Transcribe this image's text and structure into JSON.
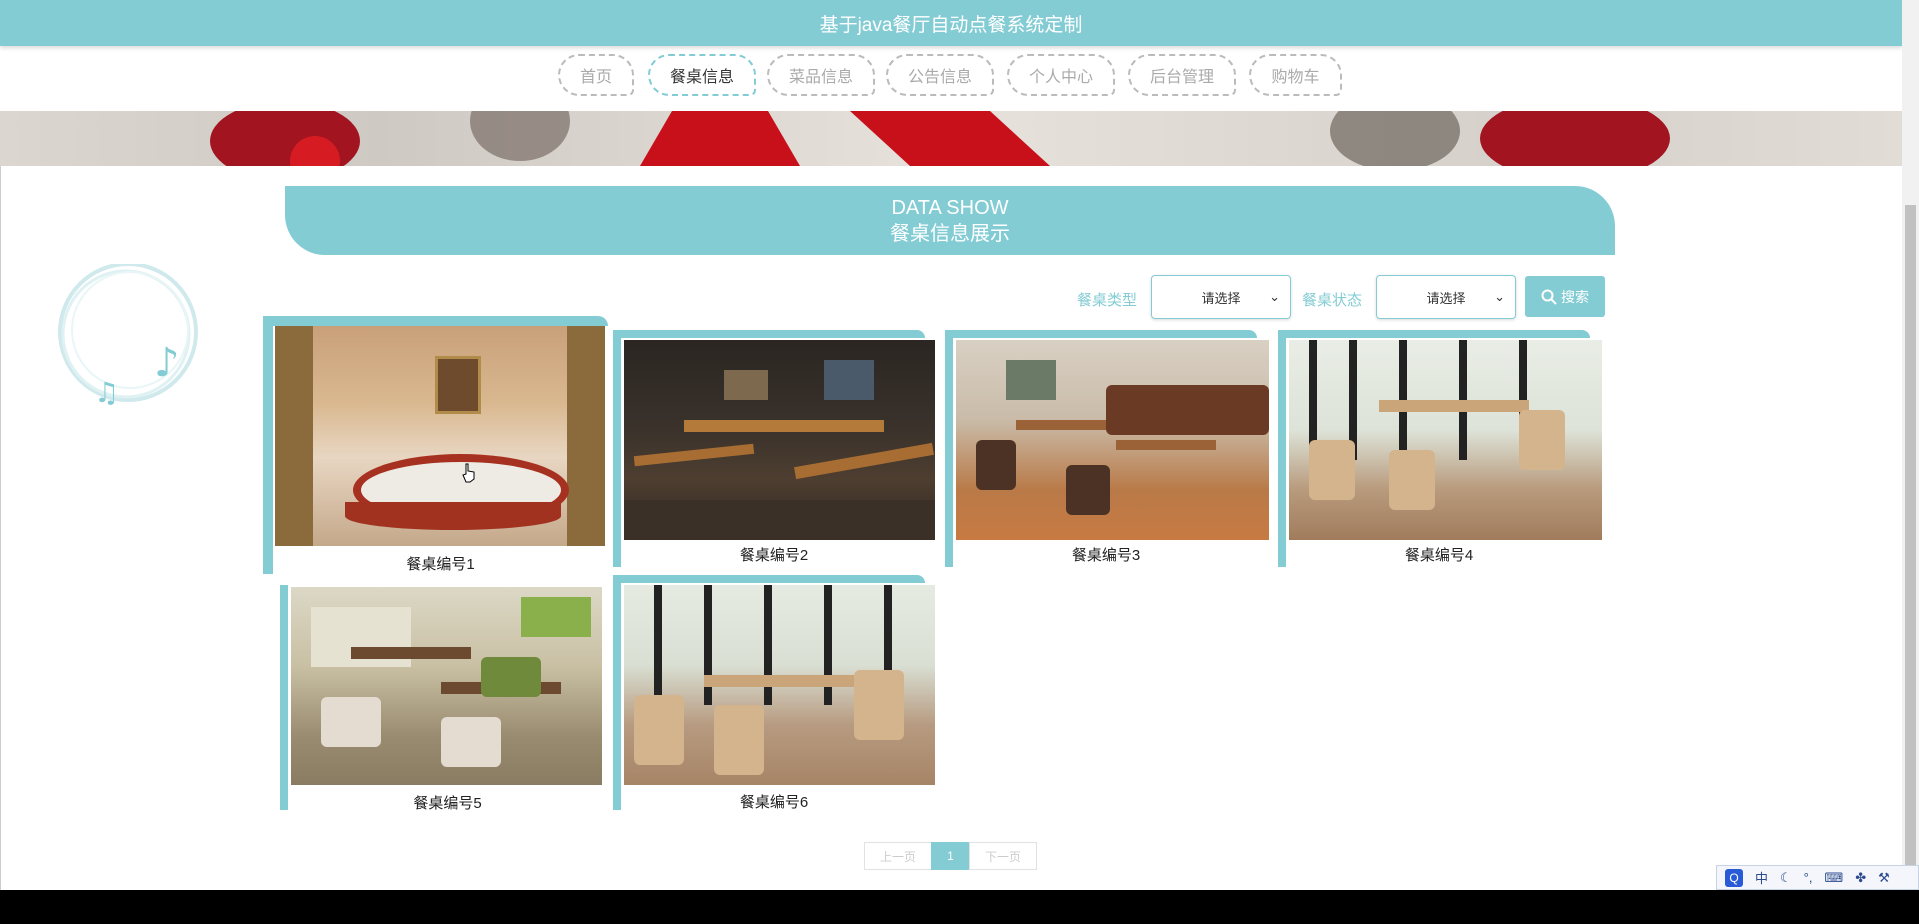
{
  "app": {
    "title": "基于java餐厅自动点餐系统定制"
  },
  "nav": {
    "items": [
      {
        "label": "首页"
      },
      {
        "label": "餐桌信息"
      },
      {
        "label": "菜品信息"
      },
      {
        "label": "公告信息"
      },
      {
        "label": "个人中心"
      },
      {
        "label": "后台管理"
      },
      {
        "label": "购物车"
      }
    ],
    "active_index": 1
  },
  "section": {
    "title_en": "DATA SHOW",
    "title_cn": "餐桌信息展示"
  },
  "filters": {
    "type_label": "餐桌类型",
    "type_value": "请选择",
    "status_label": "餐桌状态",
    "status_value": "请选择",
    "search_label": "搜索"
  },
  "tables": [
    {
      "name": "餐桌编号1"
    },
    {
      "name": "餐桌编号2"
    },
    {
      "name": "餐桌编号3"
    },
    {
      "name": "餐桌编号4"
    },
    {
      "name": "餐桌编号5"
    },
    {
      "name": "餐桌编号6"
    }
  ],
  "pagination": {
    "prev": "上一页",
    "current": "1",
    "next": "下一页"
  },
  "tray": {
    "icons": [
      "q-icon",
      "ime-zh-icon",
      "moon-icon",
      "punctuation-icon",
      "keyboard-icon",
      "tool-icon",
      "wrench-icon"
    ],
    "zh": "中"
  },
  "colors": {
    "accent": "#84ccd4"
  }
}
